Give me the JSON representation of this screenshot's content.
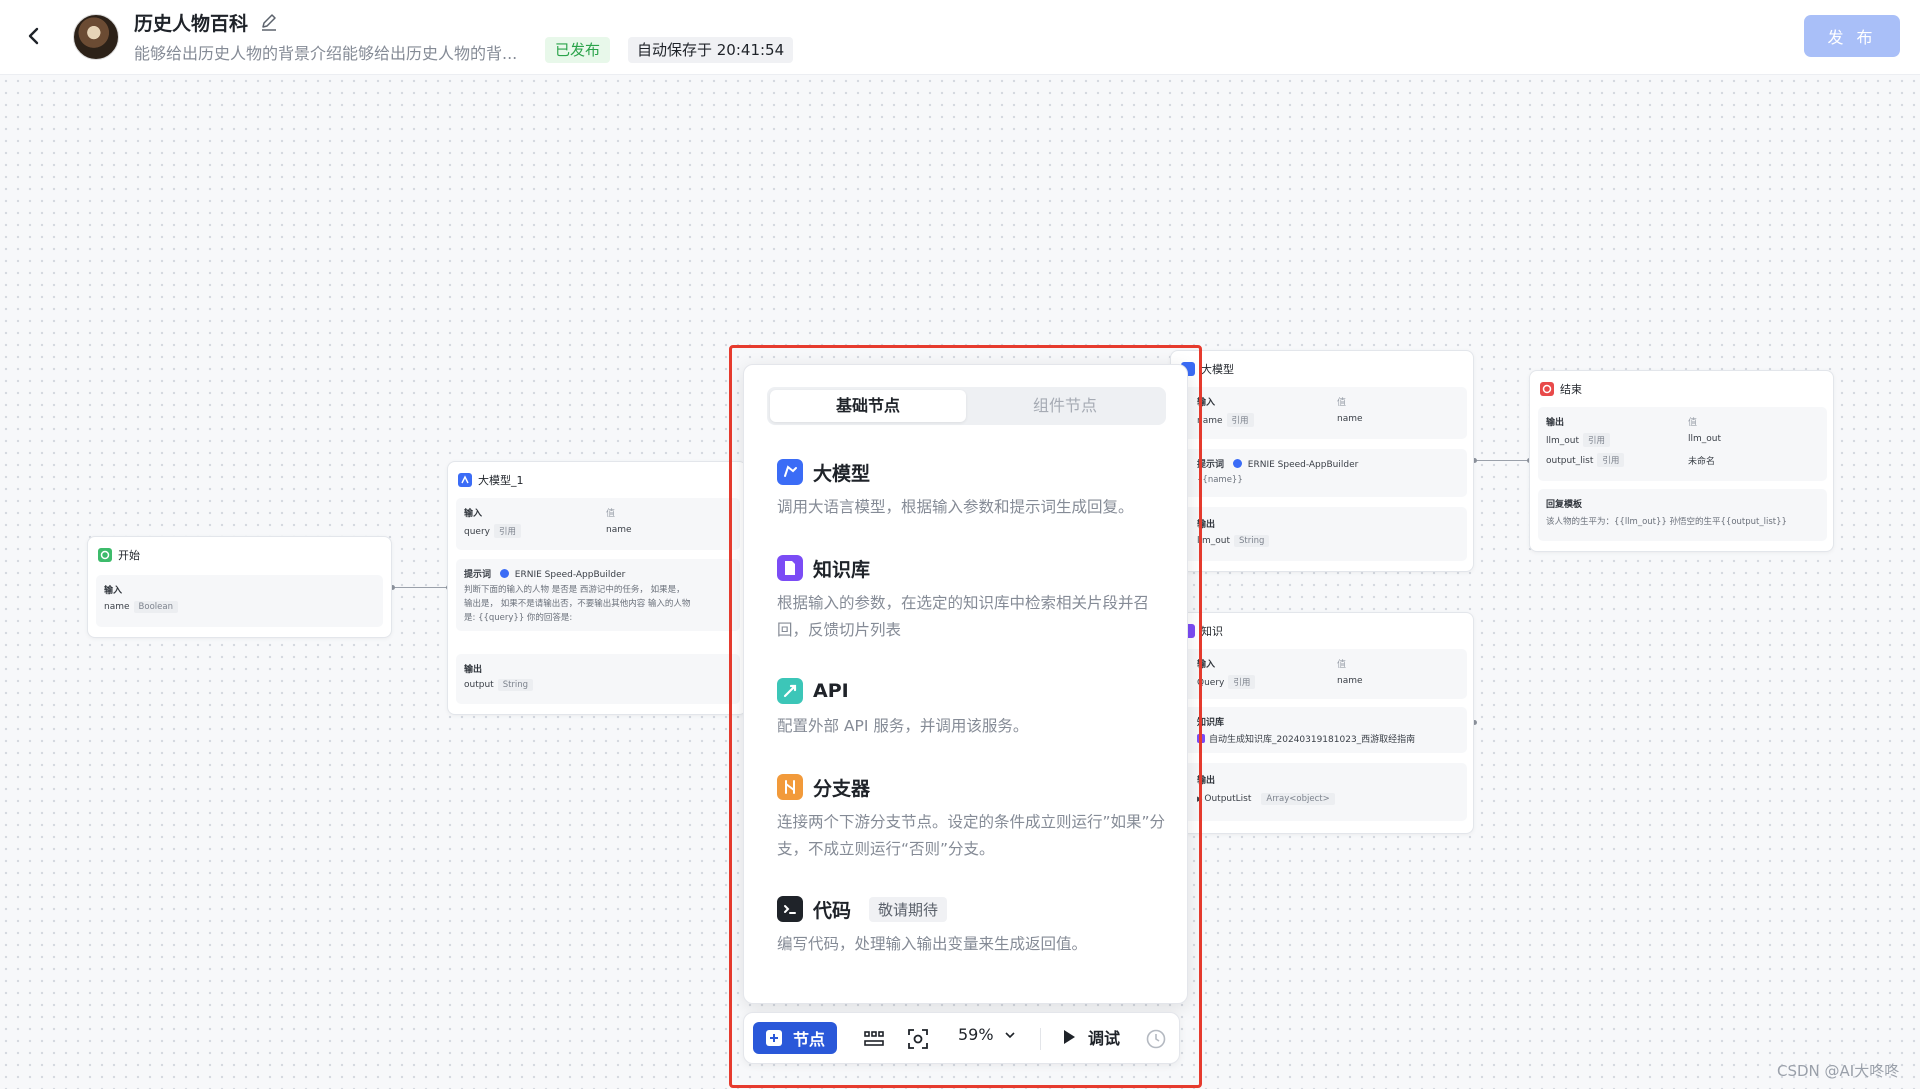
{
  "header": {
    "back_icon": "chevron-left-icon",
    "app_title": "历史人物百科",
    "app_description": "能够给出历史人物的背景介绍能够给出历史人物的背...",
    "status_badge": "已发布",
    "autosave_text": "自动保存于 20:41:54",
    "publish_label": "发 布"
  },
  "nodes": {
    "start": {
      "title": "开始",
      "input_label": "输入",
      "param_name": "name",
      "param_type": "Boolean"
    },
    "llm1": {
      "title": "大模型_1",
      "input_label": "输入",
      "value_header": "值",
      "param_name": "query",
      "param_ref": "引用",
      "param_value": "name",
      "prompt_label": "提示词",
      "model_name": "ERNIE Speed-AppBuilder",
      "prompt_line1": "判断下面的输入的人物 是否是 西游记中的任务， 如果是，",
      "prompt_line2": "输出是，  如果不是请输出否，不要输出其他内容 输入的人物",
      "prompt_line3": "是: {{query}} 你的回答是:",
      "output_label": "输出",
      "output_name": "output",
      "output_type": "String"
    },
    "llm2": {
      "title": "大模型",
      "input_label": "输入",
      "value_header": "值",
      "param_name": "name",
      "param_ref": "引用",
      "param_value": "name",
      "prompt_label": "提示词",
      "model_name": "ERNIE Speed-AppBuilder",
      "prompt_line1": "{{name}}",
      "output_label": "输出",
      "output_name": "llm_out",
      "output_type": "String"
    },
    "knowledge": {
      "title": "知识",
      "input_label": "输入",
      "value_header": "值",
      "param_name": "Query",
      "param_ref": "引用",
      "param_value": "name",
      "kb_label": "知识库",
      "kb_name": "自动生成知识库_20240319181023_西游取经指南",
      "output_label": "输出",
      "output_name": "OutputList",
      "output_type": "Array<object>"
    },
    "end": {
      "title": "结束",
      "output_label": "输出",
      "value_header": "值",
      "row1_name": "llm_out",
      "row1_ref": "引用",
      "row1_value": "llm_out",
      "row2_name": "output_list",
      "row2_ref": "引用",
      "row2_value": "未命名",
      "template_label": "回复模板",
      "template_text": "该人物的生平为：{{llm_out}} 孙悟空的生平{{output_list}}"
    }
  },
  "panel": {
    "tabs": [
      "基础节点",
      "组件节点"
    ],
    "items": [
      {
        "name": "大模型",
        "icon": "llm-icon",
        "color": "#3b6cf6",
        "desc": "调用大语言模型，根据输入参数和提示词生成回复。"
      },
      {
        "name": "知识库",
        "icon": "knowledge-base-icon",
        "color": "#7b4cf5",
        "desc": "根据输入的参数，在选定的知识库中检索相关片段并召回，反馈切片列表"
      },
      {
        "name": "API",
        "icon": "api-icon",
        "color": "#3cc6b8",
        "desc": "配置外部 API 服务，并调用该服务。"
      },
      {
        "name": "分支器",
        "icon": "branch-icon",
        "color": "#f29a3a",
        "desc": "连接两个下游分支节点。设定的条件成立则运行”如果”分支，不成立则运行“否则”分支。"
      },
      {
        "name": "代码",
        "icon": "code-icon",
        "color": "#1f2329",
        "desc": "编写代码，处理输入输出变量来生成返回值。",
        "badge": "敬请期待"
      }
    ]
  },
  "toolbar": {
    "add_node_label": "节点",
    "zoom_level": "59%",
    "debug_label": "调试"
  },
  "watermark": "CSDN @AI大咚咚"
}
